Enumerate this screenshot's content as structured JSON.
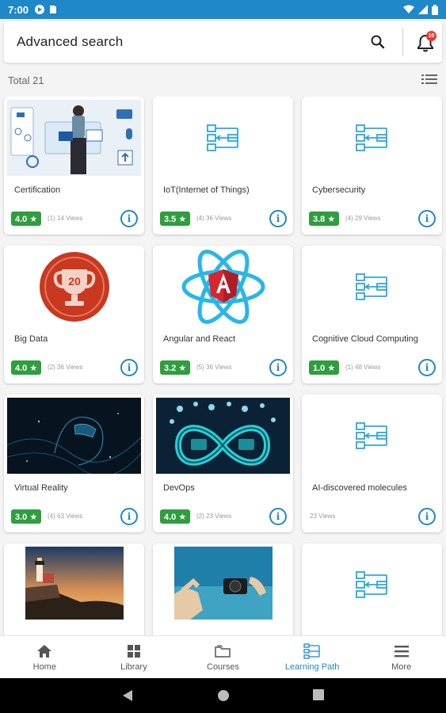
{
  "status_bar": {
    "time": "7:00"
  },
  "search": {
    "placeholder": "Advanced search",
    "notification_count": "10"
  },
  "total": {
    "label": "Total 21"
  },
  "colors": {
    "accent": "#1e88c8",
    "rating_green": "#2e9e3e",
    "badge_red": "#e53935"
  },
  "cards": [
    {
      "title": "Certification",
      "rating": "4.0 ★",
      "views": "(1) 14 Views",
      "thumb": "certification-illustration"
    },
    {
      "title": "IoT(Internet of Things)",
      "rating": "3.5 ★",
      "views": "(4) 36 Views",
      "thumb": "learning-path-icon"
    },
    {
      "title": "Cybersecurity",
      "rating": "3.8 ★",
      "views": "(4) 29 Views",
      "thumb": "learning-path-icon"
    },
    {
      "title": "Big Data",
      "rating": "4.0 ★",
      "views": "(2) 36 Views",
      "thumb": "trophy-badge"
    },
    {
      "title": "Angular and React",
      "rating": "3.2 ★",
      "views": "(5) 36 Views",
      "thumb": "angular-react-logo"
    },
    {
      "title": "Cognitive Cloud Computing",
      "rating": "1.0 ★",
      "views": "(1) 48 Views",
      "thumb": "learning-path-icon"
    },
    {
      "title": "Virtual Reality",
      "rating": "3.0 ★",
      "views": "(4) 63 Views",
      "thumb": "vr-image"
    },
    {
      "title": "DevOps",
      "rating": "4.0 ★",
      "views": "(2) 23 Views",
      "thumb": "devops-image"
    },
    {
      "title": "AI-discovered molecules",
      "rating": "",
      "views": "23 Views",
      "thumb": "learning-path-icon"
    },
    {
      "title": "",
      "rating": "",
      "views": "",
      "thumb": "lighthouse-image"
    },
    {
      "title": "",
      "rating": "",
      "views": "",
      "thumb": "underwater-camera-image"
    },
    {
      "title": "",
      "rating": "",
      "views": "",
      "thumb": "learning-path-icon"
    }
  ],
  "bottom_nav": [
    {
      "label": "Home",
      "icon": "home-icon"
    },
    {
      "label": "Library",
      "icon": "grid-icon"
    },
    {
      "label": "Courses",
      "icon": "folder-icon"
    },
    {
      "label": "Learning Path",
      "icon": "learning-path-icon",
      "active": true
    },
    {
      "label": "More",
      "icon": "menu-icon"
    }
  ]
}
